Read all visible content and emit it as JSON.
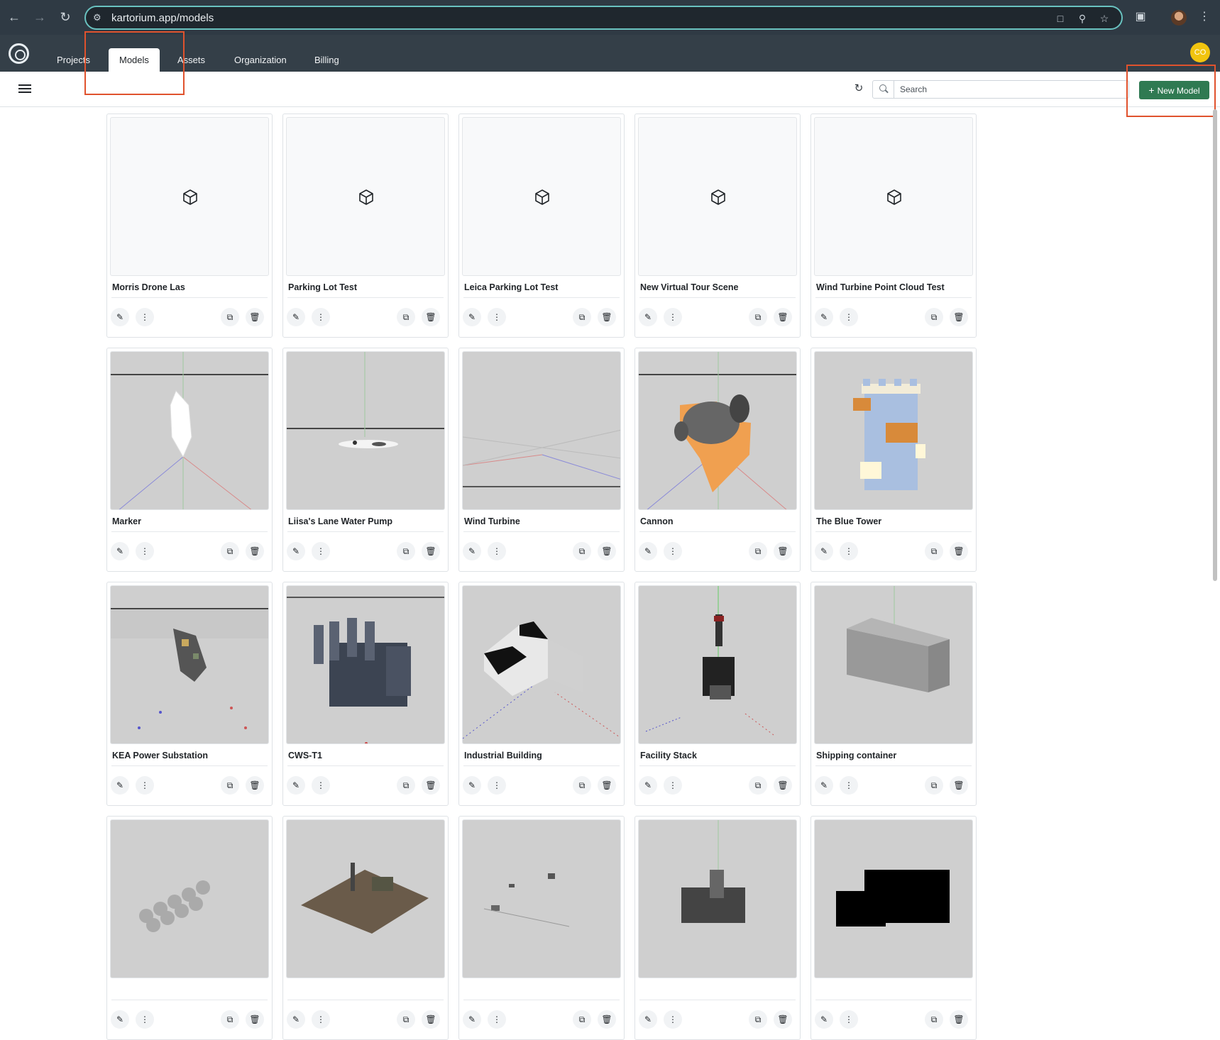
{
  "browser": {
    "url": "kartorium.app/models",
    "back_icon": "arrow-left-icon",
    "forward_icon": "arrow-right-icon",
    "reload_icon": "reload-icon"
  },
  "app": {
    "tabs": [
      {
        "label": "Projects"
      },
      {
        "label": "Models"
      },
      {
        "label": "Assets"
      },
      {
        "label": "Organization"
      },
      {
        "label": "Billing"
      }
    ],
    "active_tab": "Models",
    "user_initials": "CO",
    "avatar_color": "#f1c40f"
  },
  "toolbar": {
    "search_placeholder": "Search",
    "new_model_label": "New Model",
    "new_model_color": "#2f7a52"
  },
  "highlight_color": "#e0522d",
  "models": [
    {
      "name": "Morris Drone Las"
    },
    {
      "name": "Parking Lot Test"
    },
    {
      "name": "Leica Parking Lot Test"
    },
    {
      "name": "New Virtual Tour Scene"
    },
    {
      "name": "Wind Turbine Point Cloud Test"
    },
    {
      "name": "Marker"
    },
    {
      "name": "Liisa's Lane Water Pump"
    },
    {
      "name": "Wind Turbine"
    },
    {
      "name": "Cannon"
    },
    {
      "name": "The Blue Tower"
    },
    {
      "name": "KEA Power Substation"
    },
    {
      "name": "CWS-T1"
    },
    {
      "name": "Industrial Building"
    },
    {
      "name": "Facility Stack"
    },
    {
      "name": "Shipping container"
    },
    {
      "name": ""
    },
    {
      "name": ""
    },
    {
      "name": ""
    },
    {
      "name": ""
    },
    {
      "name": ""
    }
  ]
}
